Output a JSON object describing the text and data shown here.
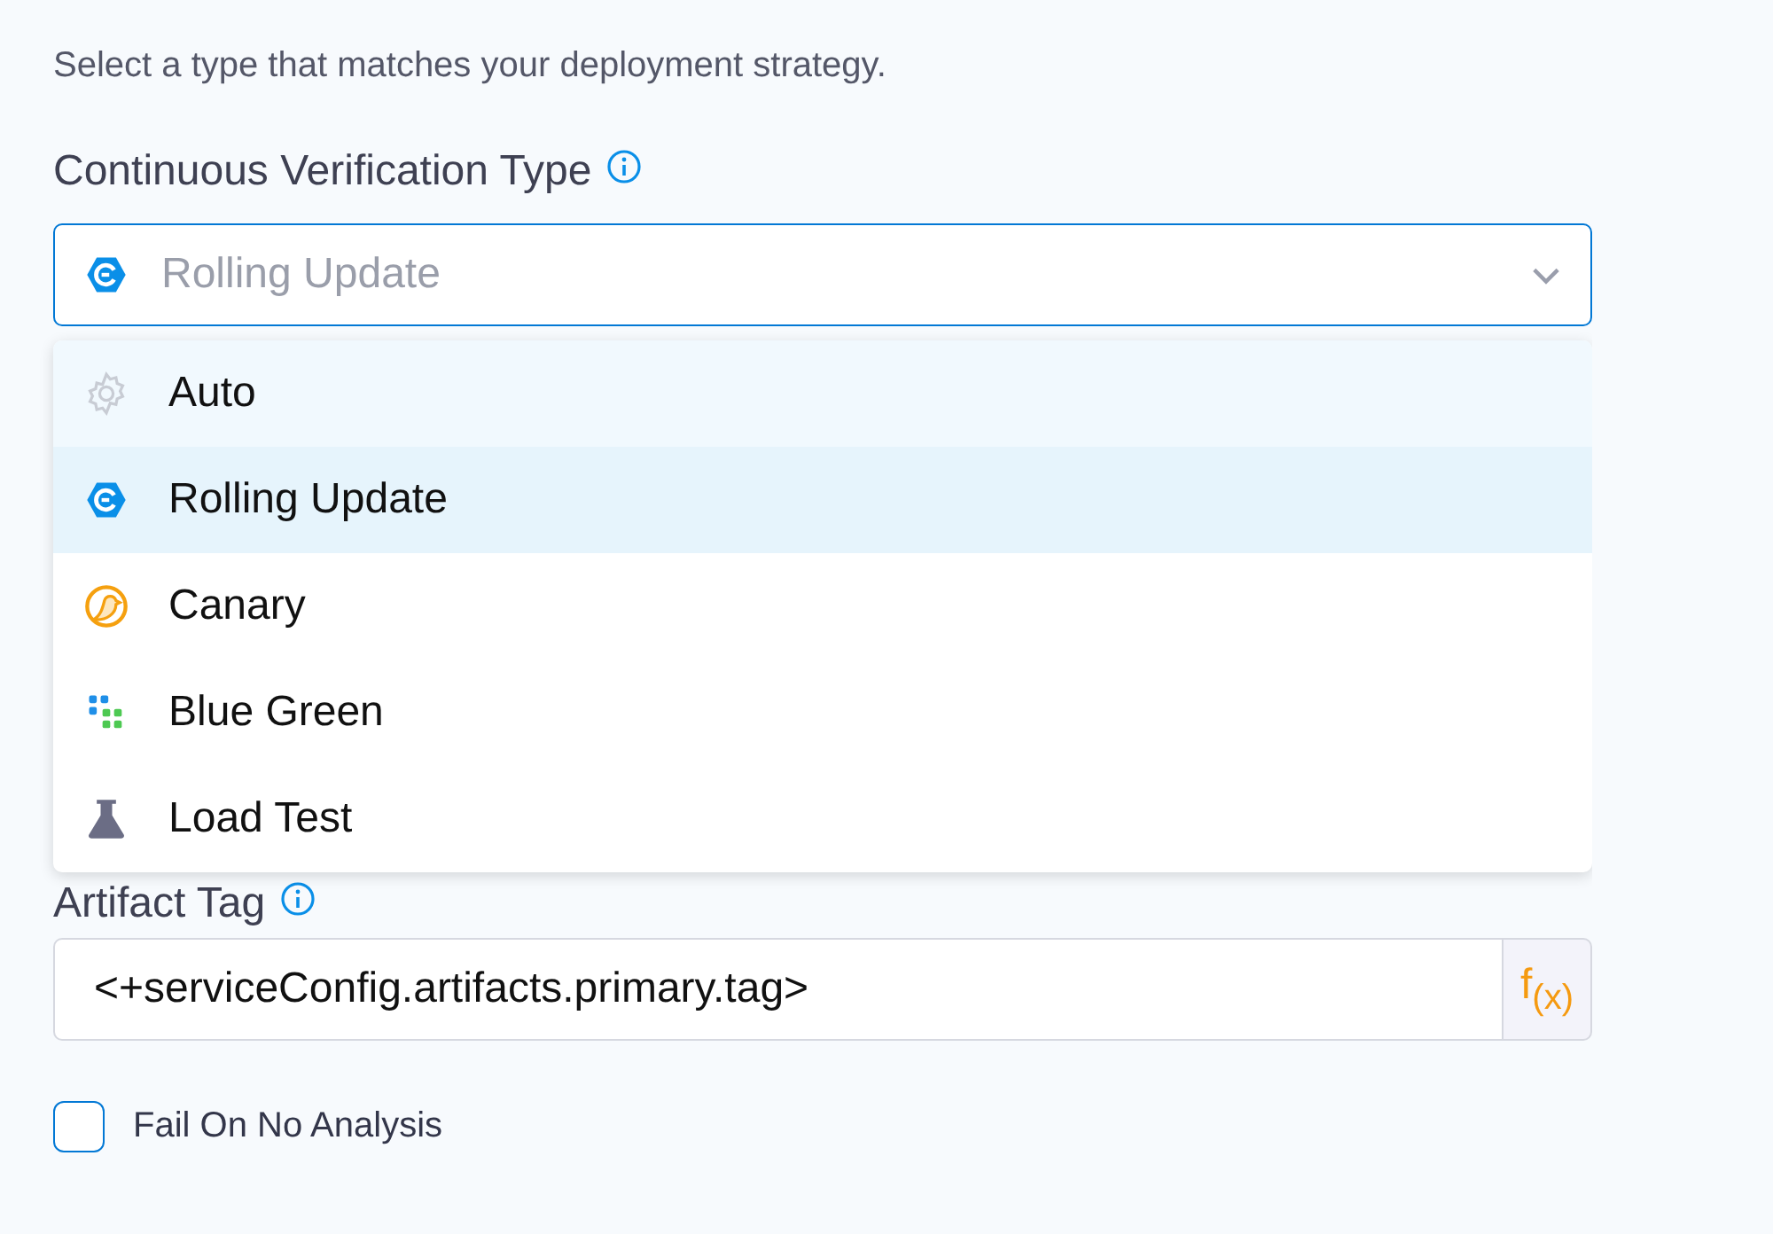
{
  "intro": "Select a type that matches your deployment strategy.",
  "verification_type": {
    "label": "Continuous Verification Type",
    "placeholder": "Rolling Update",
    "expanded": true,
    "options": [
      {
        "label": "Auto",
        "kind": "gear",
        "hovered": true,
        "selected": false
      },
      {
        "label": "Rolling Update",
        "kind": "rolling",
        "hovered": false,
        "selected": true
      },
      {
        "label": "Canary",
        "kind": "canary",
        "hovered": false,
        "selected": false
      },
      {
        "label": "Blue Green",
        "kind": "bluegreen",
        "hovered": false,
        "selected": false
      },
      {
        "label": "Load Test",
        "kind": "flask",
        "hovered": false,
        "selected": false
      }
    ]
  },
  "artifact_tag": {
    "label": "Artifact Tag",
    "value": "<+serviceConfig.artifacts.primary.tag>",
    "fx_button": "f$_{(x)}$"
  },
  "fail_on_no_analysis": {
    "label": "Fail On No Analysis",
    "checked": false
  }
}
